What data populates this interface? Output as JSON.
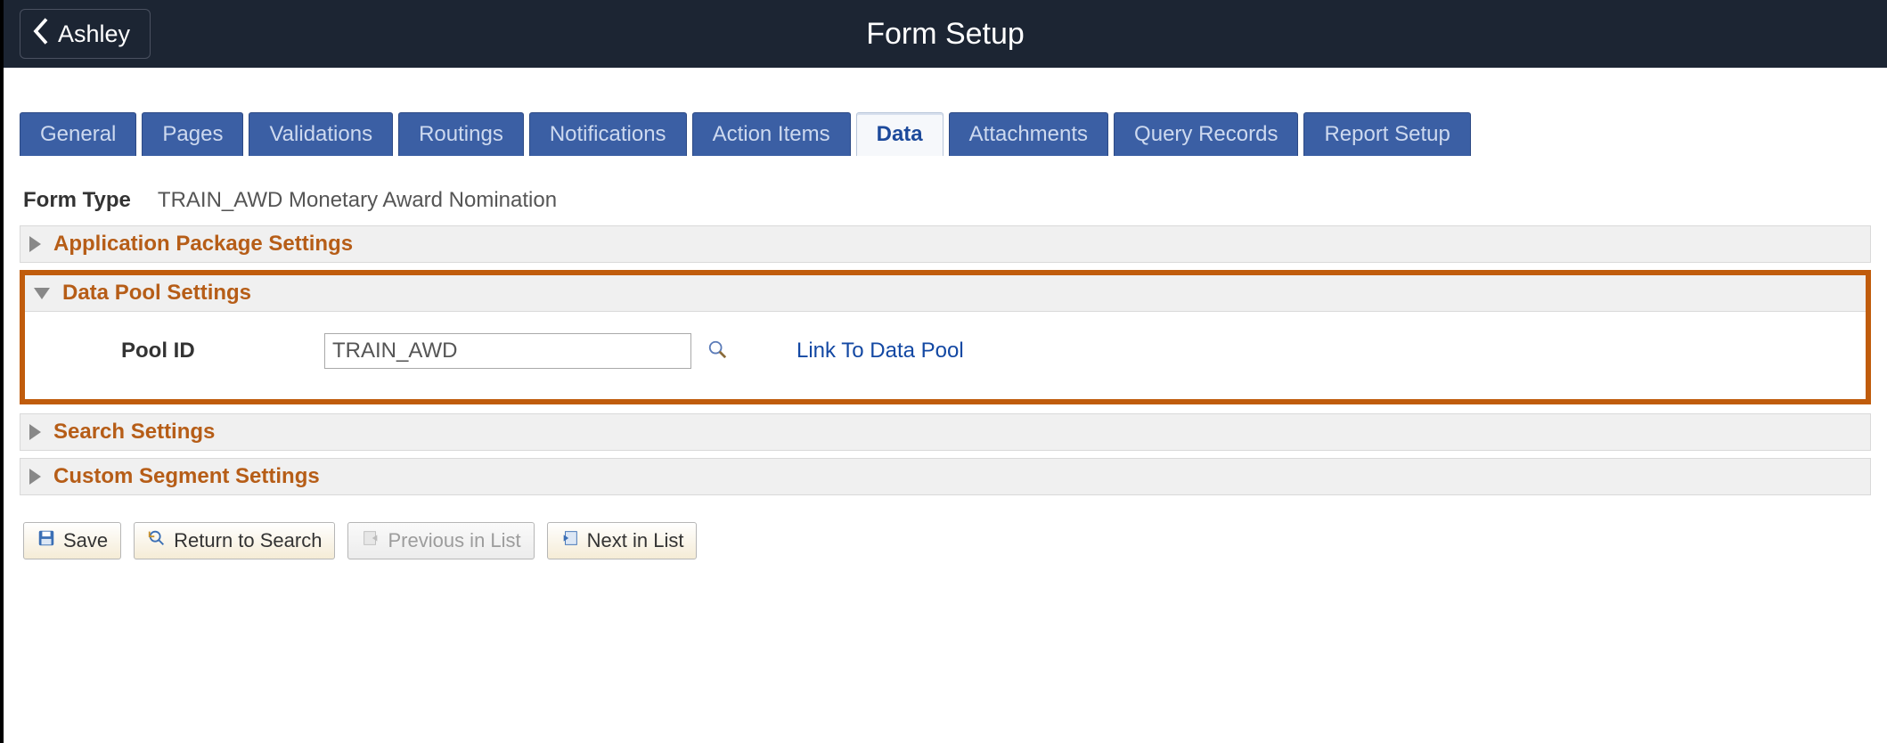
{
  "header": {
    "back_label": "Ashley",
    "title": "Form Setup"
  },
  "tabs": {
    "items": [
      "General",
      "Pages",
      "Validations",
      "Routings",
      "Notifications",
      "Action Items",
      "Data",
      "Attachments",
      "Query Records",
      "Report Setup"
    ],
    "active_index": 6
  },
  "form_type": {
    "label": "Form Type",
    "value": "TRAIN_AWD Monetary Award Nomination"
  },
  "sections": {
    "app_pkg": {
      "title": "Application Package Settings",
      "expanded": false
    },
    "data_pool": {
      "title": "Data Pool Settings",
      "expanded": true,
      "pool_id": {
        "label": "Pool ID",
        "value": "TRAIN_AWD"
      },
      "link_label": "Link To Data Pool"
    },
    "search": {
      "title": "Search Settings",
      "expanded": false
    },
    "custom_seg": {
      "title": "Custom Segment Settings",
      "expanded": false
    }
  },
  "buttons": {
    "save": "Save",
    "return_search": "Return to Search",
    "prev_in_list": "Previous in List",
    "next_in_list": "Next in List"
  }
}
